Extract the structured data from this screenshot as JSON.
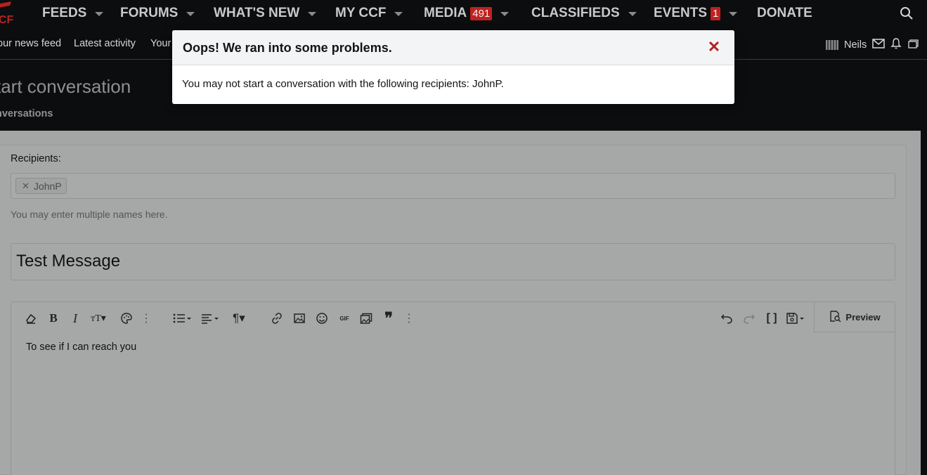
{
  "nav": {
    "logo_text": "CF",
    "items": [
      {
        "label": "FEEDS"
      },
      {
        "label": "FORUMS"
      },
      {
        "label": "WHAT'S NEW"
      },
      {
        "label": "MY CCF"
      },
      {
        "label": "MEDIA",
        "badge": "491"
      },
      {
        "label": "CLASSIFIEDS"
      },
      {
        "label": "EVENTS",
        "badge": "1"
      },
      {
        "label": "DONATE"
      }
    ],
    "badge_color": "#c0201f"
  },
  "subnav": {
    "items": [
      "our news feed",
      "Latest activity",
      "Your"
    ],
    "user_name": "Neils"
  },
  "page": {
    "title": "tart conversation",
    "breadcrumb": "nversations"
  },
  "form": {
    "recipients_label": "Recipients:",
    "recipient_token": "JohnP",
    "recipients_hint": "You may enter multiple names here.",
    "title_value": "Test Message",
    "body_text": "To see if I can reach you",
    "preview_label": "Preview"
  },
  "modal": {
    "title": "Oops! We ran into some problems.",
    "message": "You may not start a conversation with the following recipients: JohnP.",
    "close_color": "#b32222"
  }
}
